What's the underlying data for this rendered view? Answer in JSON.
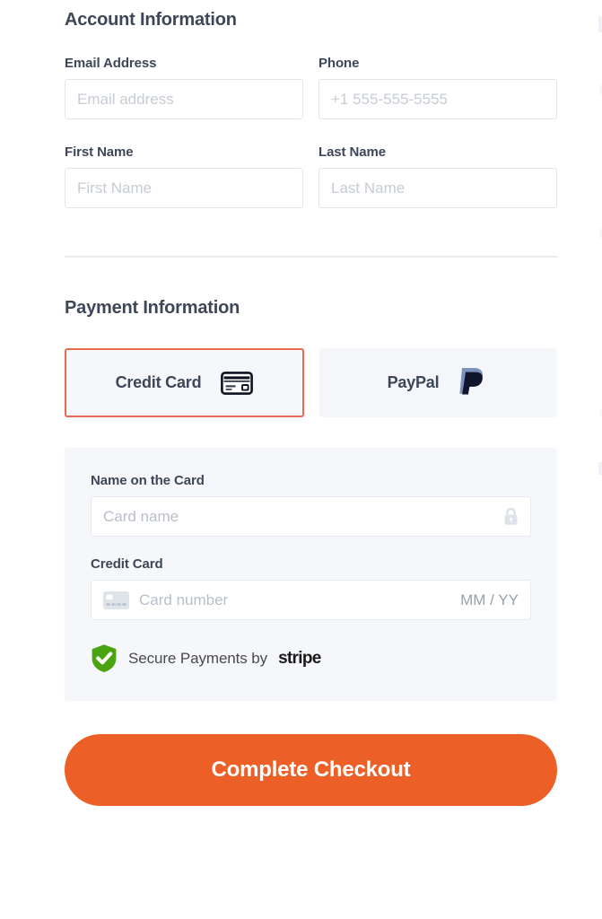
{
  "account_section": {
    "heading": "Account Information",
    "fields": [
      {
        "label": "Email Address",
        "placeholder": "Email address",
        "value": ""
      },
      {
        "label": "Phone",
        "placeholder": "+1 555-555-5555",
        "value": ""
      },
      {
        "label": "First Name",
        "placeholder": "First Name",
        "value": ""
      },
      {
        "label": "Last Name",
        "placeholder": "Last Name",
        "value": ""
      }
    ]
  },
  "payment_section": {
    "heading": "Payment Information",
    "methods": [
      {
        "label": "Credit Card",
        "icon": "credit-card-icon",
        "selected": true
      },
      {
        "label": "PayPal",
        "icon": "paypal-icon",
        "selected": false
      }
    ],
    "card_form": {
      "name_label": "Name on the Card",
      "name_placeholder": "Card name",
      "name_value": "",
      "name_icon": "lock-icon",
      "number_label": "Credit Card",
      "number_placeholder": "Card number",
      "number_value": "",
      "number_icon": "card-chip-icon",
      "expiry_placeholder": "MM / YY"
    },
    "secure_badge": {
      "icon": "shield-check-icon",
      "text": "Secure Payments by",
      "brand": "stripe"
    }
  },
  "submit": {
    "label": "Complete Checkout"
  },
  "colors": {
    "accent_orange": "#ec5f26",
    "selected_border": "#ea6a52",
    "heading_text": "#3d4758",
    "panel_background": "#f5f7fa",
    "input_border": "#e2e6ec",
    "placeholder_text": "#c7ccd4",
    "divider": "#eaeef3",
    "shield_green": "#4aa310",
    "paypal_light": "#7b92bc",
    "paypal_dark": "#10152b"
  }
}
